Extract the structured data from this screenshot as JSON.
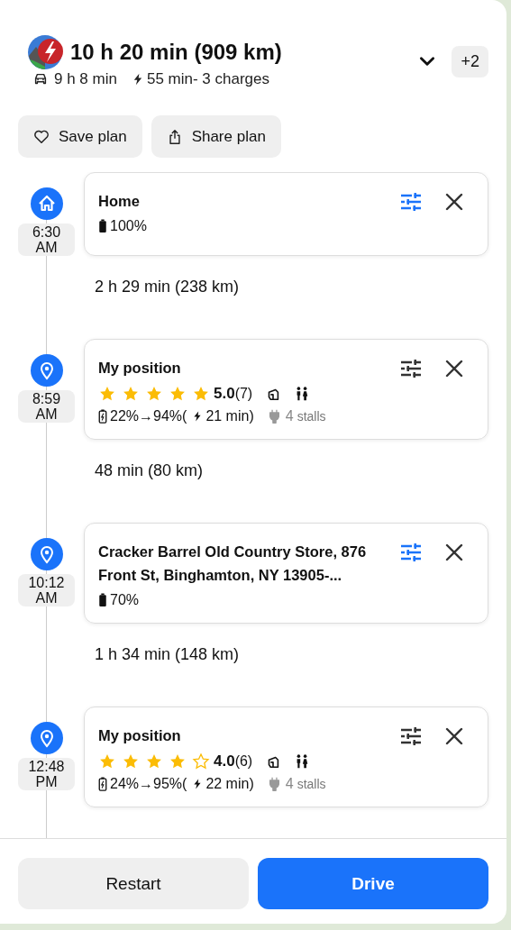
{
  "header": {
    "title": "10 h 20 min (909 km)",
    "drive_time": "9 h 8 min",
    "charge_summary": "55 min- 3 charges",
    "more_badge": "+2"
  },
  "actions": [
    {
      "kind": "save",
      "label": "Save plan"
    },
    {
      "kind": "share",
      "label": "Share plan"
    }
  ],
  "stops": [
    {
      "kind": "home",
      "time": "6:30",
      "period": "AM",
      "name": "Home",
      "settings_highlighted": true,
      "battery": "100%",
      "leg": "2 h 29 min (238 km)"
    },
    {
      "kind": "charger",
      "time": "8:59",
      "period": "AM",
      "name": "My position",
      "settings_highlighted": false,
      "stars": 5,
      "rating": "5.0",
      "reviews": "(7)",
      "charge_range": "22%→94%(",
      "charge_time": "21 min)",
      "stalls_count": "4",
      "stalls_label": "stalls",
      "leg": "48 min (80 km)"
    },
    {
      "kind": "place",
      "time": "10:12",
      "period": "AM",
      "name": "Cracker Barrel Old Country Store, 876 Front St, Binghamton, NY 13905-...",
      "settings_highlighted": true,
      "battery": "70%",
      "leg": "1 h 34 min (148 km)"
    },
    {
      "kind": "charger",
      "time": "12:48",
      "period": "PM",
      "name": "My position",
      "settings_highlighted": false,
      "stars": 4,
      "rating": "4.0",
      "reviews": "(6)",
      "charge_range": "24%→95%(",
      "charge_time": "22 min)",
      "stalls_count": "4",
      "stalls_label": "stalls"
    }
  ],
  "footer": {
    "restart": "Restart",
    "drive": "Drive"
  }
}
